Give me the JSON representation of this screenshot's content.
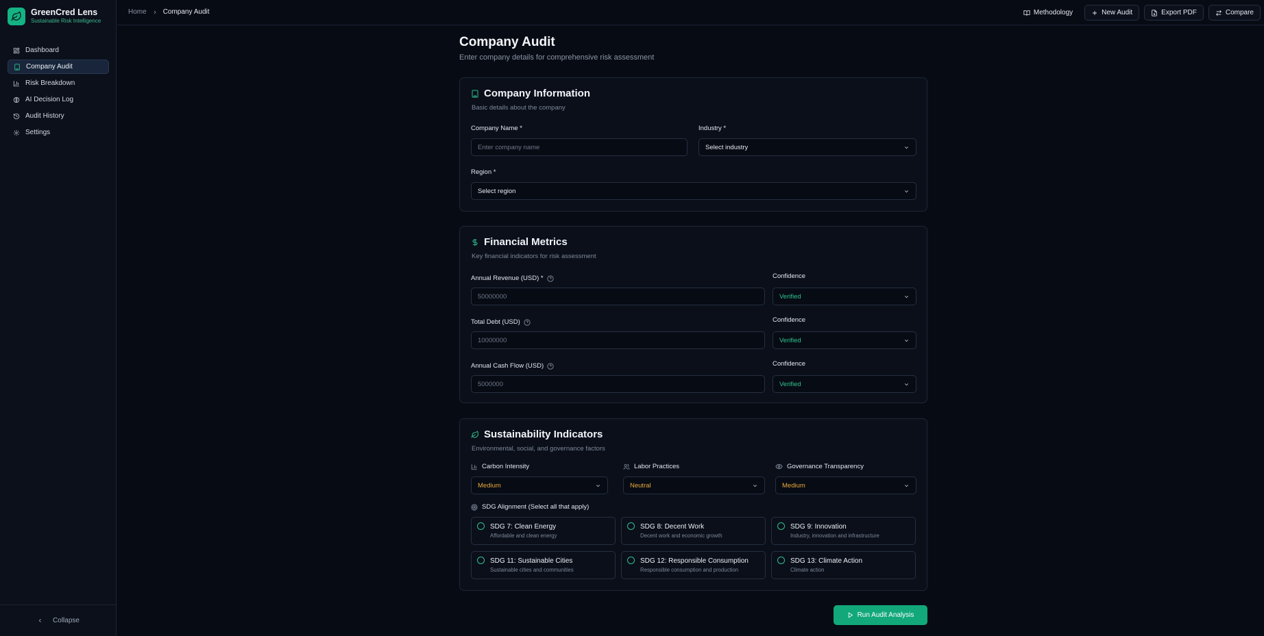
{
  "brand": {
    "name": "GreenCred Lens",
    "tagline": "Sustainable Risk Intelligence",
    "logo_icon": "leaf-icon"
  },
  "sidebar": {
    "items": [
      {
        "label": "Dashboard",
        "icon": "dashboard-icon",
        "active": false
      },
      {
        "label": "Company Audit",
        "icon": "building-icon",
        "active": true
      },
      {
        "label": "Risk Breakdown",
        "icon": "bar-chart-icon",
        "active": false
      },
      {
        "label": "AI Decision Log",
        "icon": "brain-icon",
        "active": false
      },
      {
        "label": "Audit History",
        "icon": "history-icon",
        "active": false
      },
      {
        "label": "Settings",
        "icon": "gear-icon",
        "active": false
      }
    ],
    "collapse_label": "Collapse"
  },
  "header": {
    "breadcrumb": {
      "home": "Home",
      "current": "Company Audit"
    },
    "actions": {
      "methodology": "Methodology",
      "new_audit": "New Audit",
      "export_pdf": "Export PDF",
      "compare": "Compare"
    }
  },
  "page": {
    "title": "Company Audit",
    "subtitle": "Enter company details for comprehensive risk assessment"
  },
  "company_info": {
    "title": "Company Information",
    "subtitle": "Basic details about the company",
    "company_name": {
      "label": "Company Name *",
      "placeholder": "Enter company name",
      "value": ""
    },
    "industry": {
      "label": "Industry *",
      "value": "Select industry"
    },
    "region": {
      "label": "Region *",
      "value": "Select region"
    }
  },
  "financial": {
    "title": "Financial Metrics",
    "subtitle": "Key financial indicators for risk assessment",
    "confidence_label": "Confidence",
    "rows": [
      {
        "label": "Annual Revenue (USD) *",
        "placeholder": "50000000",
        "confidence": "Verified"
      },
      {
        "label": "Total Debt (USD)",
        "placeholder": "10000000",
        "confidence": "Verified"
      },
      {
        "label": "Annual Cash Flow (USD)",
        "placeholder": "5000000",
        "confidence": "Verified"
      }
    ]
  },
  "sustainability": {
    "title": "Sustainability Indicators",
    "subtitle": "Environmental, social, and governance factors",
    "carbon": {
      "label": "Carbon Intensity",
      "value": "Medium"
    },
    "labor": {
      "label": "Labor Practices",
      "value": "Neutral"
    },
    "governance": {
      "label": "Governance Transparency",
      "value": "Medium"
    },
    "sdg_label": "SDG Alignment (Select all that apply)",
    "sdgs": [
      {
        "title": "SDG 7: Clean Energy",
        "desc": "Affordable and clean energy"
      },
      {
        "title": "SDG 8: Decent Work",
        "desc": "Decent work and economic growth"
      },
      {
        "title": "SDG 9: Innovation",
        "desc": "Industry, innovation and infrastructure"
      },
      {
        "title": "SDG 11: Sustainable Cities",
        "desc": "Sustainable cities and communities"
      },
      {
        "title": "SDG 12: Responsible Consumption",
        "desc": "Responsible consumption and production"
      },
      {
        "title": "SDG 13: Climate Action",
        "desc": "Climate action"
      }
    ]
  },
  "run_button": "Run Audit Analysis",
  "colors": {
    "accent": "#14b383",
    "verified": "#2fc38e",
    "amber": "#e8a838",
    "background": "#070b14"
  }
}
